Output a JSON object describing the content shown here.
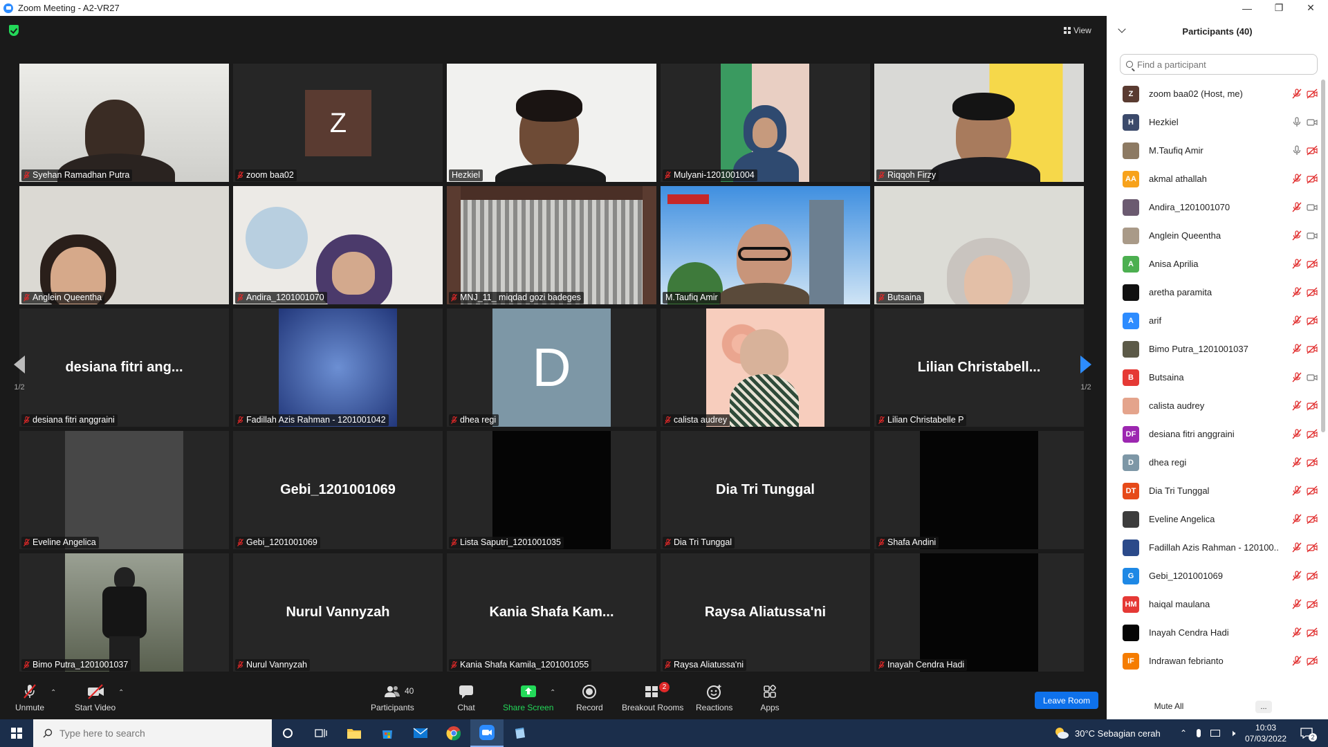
{
  "window": {
    "title": "Zoom Meeting - A2-VR27"
  },
  "meeting": {
    "view_label": "View",
    "page_left": "1/2",
    "page_right": "1/2"
  },
  "tiles": [
    {
      "name": "Syehan Ramadhan Putra"
    },
    {
      "name": "zoom baa02",
      "initial": "Z"
    },
    {
      "name": "Hezkiel"
    },
    {
      "name": "Mulyani-1201001004"
    },
    {
      "name": "Riqqoh Firzy"
    },
    {
      "name": "Anglein Queentha"
    },
    {
      "name": "Andira_1201001070"
    },
    {
      "name": "MNJ_11_ miqdad gozi badeges"
    },
    {
      "name": "M.Taufiq Amir"
    },
    {
      "name": "Butsaina"
    },
    {
      "name": "desiana fitri anggraini",
      "display": "desiana fitri ang..."
    },
    {
      "name": "Fadillah Azis Rahman - 1201001042"
    },
    {
      "name": "dhea regi",
      "initial": "D"
    },
    {
      "name": "calista audrey"
    },
    {
      "name": "Lilian Christabelle P",
      "display": "Lilian  Christabell..."
    },
    {
      "name": "Eveline Angelica"
    },
    {
      "name": "Gebi_1201001069",
      "display": "Gebi_1201001069"
    },
    {
      "name": "Lista Saputri_1201001035"
    },
    {
      "name": "Dia Tri Tunggal",
      "display": "Dia Tri Tunggal"
    },
    {
      "name": "Shafa Andini"
    },
    {
      "name": "Bimo Putra_1201001037"
    },
    {
      "name": "Nurul Vannyzah",
      "display": "Nurul Vannyzah"
    },
    {
      "name": "Kania Shafa Kamila_1201001055",
      "display": "Kania  Shafa  Kam..."
    },
    {
      "name": "Raysa Aliatussa'ni",
      "display": "Raysa Aliatussa'ni"
    },
    {
      "name": "Inayah Cendra Hadi"
    }
  ],
  "toolbar": {
    "unmute": "Unmute",
    "start_video": "Start Video",
    "participants": "Participants",
    "participants_count": "40",
    "chat": "Chat",
    "share_screen": "Share Screen",
    "record": "Record",
    "breakout_rooms": "Breakout Rooms",
    "breakout_badge": "2",
    "reactions": "Reactions",
    "apps": "Apps",
    "leave_room": "Leave Room"
  },
  "panel": {
    "title": "Participants (40)",
    "search_placeholder": "Find a participant",
    "mute_all": "Mute All",
    "more": "...",
    "participants": [
      {
        "name": "zoom baa02 (Host, me)",
        "initial": "Z",
        "color": "#5a3b31"
      },
      {
        "name": "Hezkiel",
        "initial": "H",
        "color": "#3b4a6b"
      },
      {
        "name": "M.Taufiq Amir",
        "initial": "",
        "color": "#8d7a63"
      },
      {
        "name": "akmal athallah",
        "initial": "AA",
        "color": "#f7a21b"
      },
      {
        "name": "Andira_1201001070",
        "initial": "",
        "color": "#6b5a70"
      },
      {
        "name": "Anglein Queentha",
        "initial": "",
        "color": "#a99a88"
      },
      {
        "name": "Anisa Aprilia",
        "initial": "A",
        "color": "#4caf50"
      },
      {
        "name": "aretha paramita",
        "initial": "",
        "color": "#111111"
      },
      {
        "name": "arif",
        "initial": "A",
        "color": "#2d8cff"
      },
      {
        "name": "Bimo Putra_1201001037",
        "initial": "",
        "color": "#5c5a48"
      },
      {
        "name": "Butsaina",
        "initial": "B",
        "color": "#e53935"
      },
      {
        "name": "calista audrey",
        "initial": "",
        "color": "#e4a48c"
      },
      {
        "name": "desiana fitri anggraini",
        "initial": "DF",
        "color": "#9c27b0"
      },
      {
        "name": "dhea regi",
        "initial": "D",
        "color": "#7d97a6"
      },
      {
        "name": "Dia Tri Tunggal",
        "initial": "DT",
        "color": "#e64a19"
      },
      {
        "name": "Eveline Angelica",
        "initial": "",
        "color": "#3c3c3c"
      },
      {
        "name": "Fadillah Azis Rahman - 120100...",
        "initial": "",
        "color": "#2b4a8a"
      },
      {
        "name": "Gebi_1201001069",
        "initial": "G",
        "color": "#1e88e5"
      },
      {
        "name": "haiqal maulana",
        "initial": "HM",
        "color": "#e53935"
      },
      {
        "name": "Inayah Cendra Hadi",
        "initial": "",
        "color": "#050505"
      },
      {
        "name": "Indrawan febrianto",
        "initial": "IF",
        "color": "#f57c00"
      }
    ]
  },
  "taskbar": {
    "search_placeholder": "Type here to search",
    "weather": "30°C  Sebagian cerah",
    "time": "10:03",
    "date": "07/03/2022",
    "notifications": "2"
  },
  "colors": {
    "active_speaker": "#e5e55a",
    "muted_red": "#e02828",
    "share_green": "#23d959",
    "leave_blue": "#0e71eb"
  }
}
